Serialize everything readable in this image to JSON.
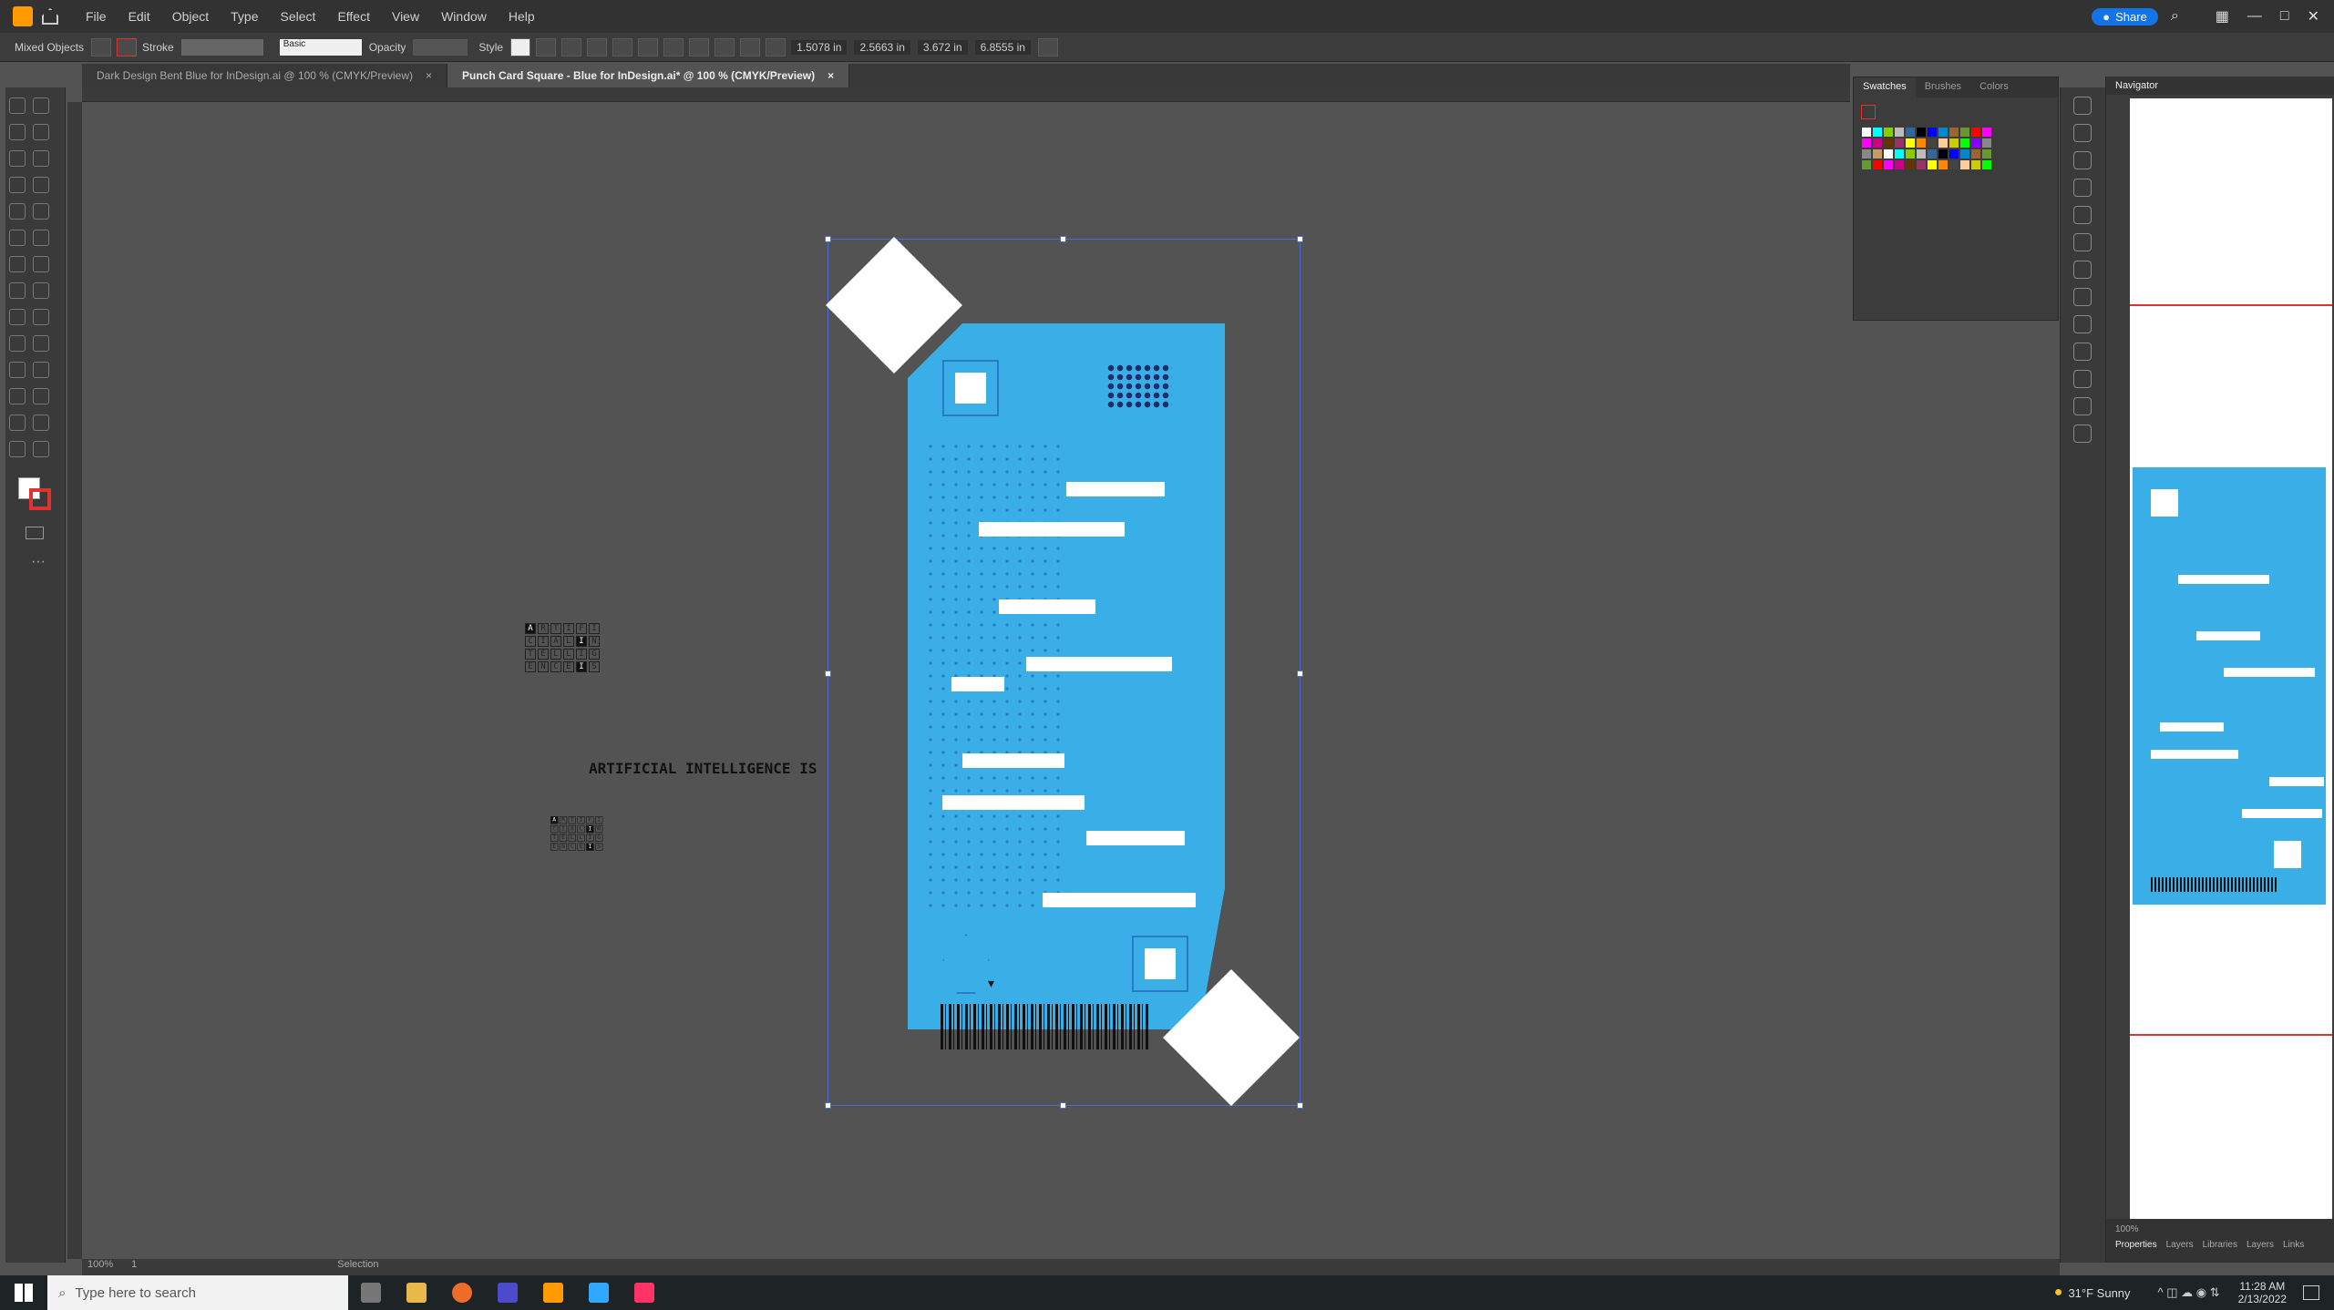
{
  "menu": {
    "items": [
      "File",
      "Edit",
      "Object",
      "Type",
      "Select",
      "Effect",
      "View",
      "Window",
      "Help"
    ],
    "share_label": "Share"
  },
  "control": {
    "selection_label": "Mixed Objects",
    "stroke_label": "Stroke",
    "opacity_label": "Opacity",
    "style_label": "Style",
    "stroke_style": "Basic",
    "x_value": "1.5078 in",
    "y_value": "2.5663 in",
    "w_value": "3.672 in",
    "h_value": "6.8555 in"
  },
  "tabs": [
    {
      "label": "Dark Design Bent Blue for InDesign.ai @ 100 % (CMYK/Preview)",
      "close": "×",
      "active": false
    },
    {
      "label": "Punch Card Square - Blue for InDesign.ai* @ 100 % (CMYK/Preview)",
      "close": "×",
      "active": true
    }
  ],
  "panels": {
    "swatches_tabs": [
      "Swatches",
      "Brushes",
      "Colors"
    ],
    "navigator_title": "Navigator",
    "navigator_zoom": "100%",
    "properties_tabs": [
      "Properties",
      "Layers",
      "Libraries",
      "Layers",
      "Links"
    ]
  },
  "canvas": {
    "headline": "ARTIFICIAL INTELLIGENCE IS",
    "grid_letters": [
      [
        "A",
        "R",
        "T",
        "I",
        "F",
        "I"
      ],
      [
        "C",
        "I",
        "A",
        "L",
        "I",
        "N"
      ],
      [
        "T",
        "E",
        "L",
        "L",
        "I",
        "G"
      ],
      [
        "E",
        "N",
        "C",
        "E",
        "I",
        "S"
      ]
    ]
  },
  "status": {
    "zoom": "100%",
    "artboard": "1",
    "mode": "Selection"
  },
  "taskbar": {
    "search_placeholder": "Type here to search",
    "weather": "31°F  Sunny",
    "time": "11:28 AM",
    "date": "2/13/2022"
  },
  "colors": {
    "card_blue": "#3aaee6",
    "dot_blue": "#2c79c8",
    "selection": "#4a6cd4",
    "swatches": [
      "#ffffff",
      "#000000",
      "#ff0000",
      "#ffff00",
      "#00ff00",
      "#00ffff",
      "#0000ff",
      "#ff00ff",
      "#ff8800",
      "#8800ff",
      "#88cc00",
      "#0088cc",
      "#cc0088",
      "#444444",
      "#888888",
      "#bbbbbb",
      "#996633",
      "#663300",
      "#ffcc99",
      "#cc9966",
      "#336699",
      "#669933",
      "#993366",
      "#cccc00"
    ]
  }
}
